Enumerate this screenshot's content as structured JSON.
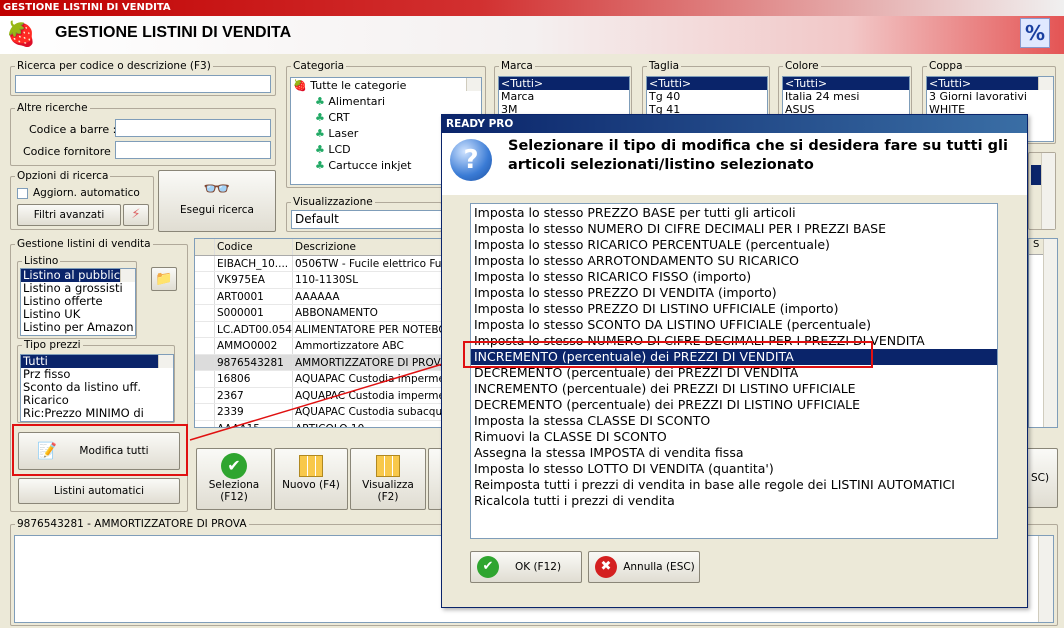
{
  "window": {
    "title": "GESTIONE LISTINI DI VENDITA"
  },
  "header": {
    "title": "GESTIONE LISTINI DI VENDITA"
  },
  "search": {
    "label": "Ricerca per codice o descrizione (F3)",
    "value": ""
  },
  "altre": {
    "label": "Altre ricerche",
    "barcode_label": "Codice a barre :",
    "supplier_label": "Codice fornitore :"
  },
  "opzioni": {
    "label": "Opzioni di ricerca",
    "auto_update": "Aggiorn. automatico",
    "advanced": "Filtri avanzati",
    "execute": "Esegui ricerca"
  },
  "categoria": {
    "label": "Categoria",
    "items": [
      "Tutte le categorie",
      "Alimentari",
      "CRT",
      "Laser",
      "LCD",
      "Cartucce inkjet"
    ]
  },
  "visualizzazione": {
    "label": "Visualizzazione",
    "value": "Default"
  },
  "marca": {
    "label": "Marca",
    "items": [
      "<Tutti>",
      "Marca",
      "3M"
    ]
  },
  "taglia": {
    "label": "Taglia",
    "items": [
      "<Tutti>",
      "Tg 40",
      "Tg 41"
    ]
  },
  "colore": {
    "label": "Colore",
    "items": [
      "<Tutti>",
      "Italia 24 mesi",
      "ASUS"
    ]
  },
  "coppa": {
    "label": "Coppa",
    "items": [
      "<Tutti>",
      "3 Giorni lavorativi",
      "WHITE"
    ]
  },
  "gestione": {
    "label": "Gestione listini di vendita",
    "listino_label": "Listino",
    "listini": [
      "Listino al pubblico",
      "Listino a grossisti",
      "Listino offerte",
      "Listino UK",
      "Listino per Amazon"
    ],
    "tipo_label": "Tipo prezzi",
    "tipi": [
      "Tutti",
      "Prz fisso",
      "Sconto da listino uff.",
      "Ricarico",
      "Ric:Prezzo MINIMO di"
    ],
    "modifica": "Modifica tutti",
    "automatici": "Listini automatici"
  },
  "table": {
    "headers": [
      "Codice",
      "Descrizione"
    ],
    "rows": [
      [
        "EIBACH_10....",
        "0506TW - Fucile elettrico Full"
      ],
      [
        "VK975EA",
        "110-1130SL"
      ],
      [
        "ART0001",
        "AAAAAA"
      ],
      [
        "S000001",
        "ABBONAMENTO"
      ],
      [
        "LC.ADT00.054",
        "ALIMENTATORE PER NOTEBO"
      ],
      [
        "AMMO0002",
        "Ammortizzatore ABC"
      ],
      [
        "9876543281",
        "AMMORTIZZATORE DI PROVA"
      ],
      [
        "16806",
        "AQUAPAC Custodia impermea"
      ],
      [
        "2367",
        "AQUAPAC Custodia impermea"
      ],
      [
        "2339",
        "AQUAPAC Custodia subacque"
      ],
      [
        "AAAA15",
        "ARTICOLO 10"
      ]
    ]
  },
  "toolbar": {
    "seleziona": "Seleziona\n(F12)",
    "nuovo": "Nuovo (F4)",
    "visualizza": "Visualizza (F2)",
    "esc_partial": "SC)"
  },
  "detail": {
    "label": "9876543281 - AMMORTIZZATORE DI PROVA"
  },
  "dialog": {
    "title": "READY PRO",
    "message": "Selezionare il tipo di modifica che si desidera fare su tutti gli articoli selezionati/listino selezionato",
    "options": [
      "Imposta lo stesso PREZZO BASE per tutti gli articoli",
      "Imposta lo stesso NUMERO DI CIFRE DECIMALI PER I PREZZI BASE",
      "Imposta lo stesso RICARICO PERCENTUALE (percentuale)",
      "Imposta lo stesso ARROTONDAMENTO SU RICARICO",
      "Imposta lo stesso RICARICO FISSO (importo)",
      "Imposta lo stesso PREZZO DI VENDITA (importo)",
      "Imposta lo stesso PREZZO DI LISTINO UFFICIALE (importo)",
      "Imposta lo stesso SCONTO DA LISTINO UFFICIALE (percentuale)",
      "Imposta lo stesso NUMERO DI CIFRE DECIMALI PER I PREZZI DI VENDITA",
      "INCREMENTO (percentuale) dei PREZZI DI VENDITA",
      "DECREMENTO (percentuale) dei PREZZI DI VENDITA",
      "INCREMENTO (percentuale) dei PREZZI DI LISTINO UFFICIALE",
      "DECREMENTO (percentuale) dei PREZZI DI LISTINO UFFICIALE",
      "Imposta la stessa CLASSE DI SCONTO",
      "Rimuovi la CLASSE DI SCONTO",
      "Assegna la stessa IMPOSTA di vendita fissa",
      "Imposta lo stesso LOTTO DI VENDITA (quantita')",
      "Reimposta tutti i prezzi di vendita in base alle regole dei LISTINI AUTOMATICI",
      "Ricalcola tutti i prezzi di vendita"
    ],
    "selected_index": 9,
    "ok": "OK (F12)",
    "cancel": "Annulla (ESC)"
  },
  "colors": {
    "highlight": "#e01010",
    "selection": "#0a246a"
  }
}
